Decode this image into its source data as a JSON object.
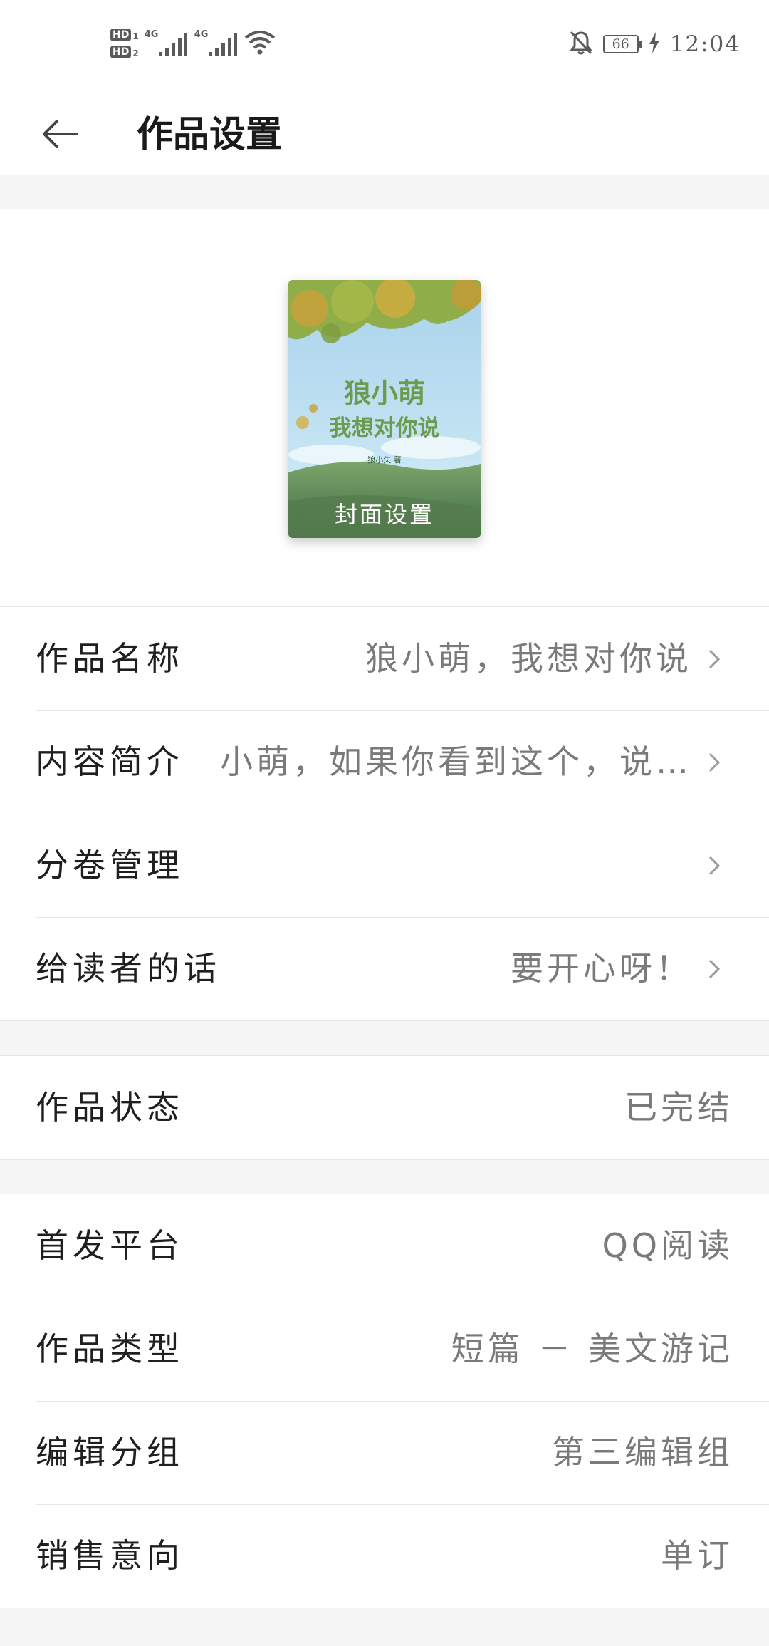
{
  "status_bar": {
    "hd1": "HD",
    "hd1_sub": "1",
    "hd2": "HD",
    "hd2_sub": "2",
    "network1": "4G",
    "network2": "4G",
    "battery": "66",
    "time": "12:04",
    "icons": [
      "signal-icon",
      "wifi-icon",
      "bell-muted-icon",
      "battery-icon",
      "charging-icon"
    ]
  },
  "header": {
    "title": "作品设置",
    "back_icon": "back-arrow-icon"
  },
  "cover": {
    "label": "封面设置",
    "art_title_line1": "狼小萌",
    "art_title_line2": "我想对你说",
    "art_author": "狼小失 著"
  },
  "groups": [
    {
      "rows": [
        {
          "label": "作品名称",
          "value": "狼小萌，我想对你说",
          "arrow": true
        },
        {
          "label": "内容简介",
          "value": "小萌，如果你看到这个，说…",
          "arrow": true
        },
        {
          "label": "分卷管理",
          "value": "",
          "arrow": true
        },
        {
          "label": "给读者的话",
          "value": "要开心呀！",
          "arrow": true
        }
      ]
    },
    {
      "rows": [
        {
          "label": "作品状态",
          "value": "已完结",
          "arrow": false
        }
      ]
    },
    {
      "rows": [
        {
          "label": "首发平台",
          "value": "QQ阅读",
          "arrow": false
        },
        {
          "label": "作品类型",
          "value": "短篇 － 美文游记",
          "arrow": false
        },
        {
          "label": "编辑分组",
          "value": "第三编辑组",
          "arrow": false
        },
        {
          "label": "销售意向",
          "value": "单订",
          "arrow": false
        }
      ]
    }
  ]
}
